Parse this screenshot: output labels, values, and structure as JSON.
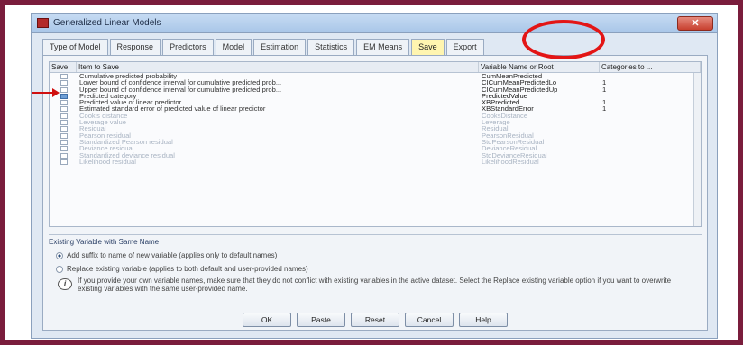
{
  "dialog": {
    "title": "Generalized Linear Models",
    "close_label": "✕"
  },
  "tabs": [
    {
      "label": "Type of Model",
      "active": false
    },
    {
      "label": "Response",
      "active": false
    },
    {
      "label": "Predictors",
      "active": false
    },
    {
      "label": "Model",
      "active": false
    },
    {
      "label": "Estimation",
      "active": false
    },
    {
      "label": "Statistics",
      "active": false
    },
    {
      "label": "EM Means",
      "active": false
    },
    {
      "label": "Save",
      "active": true
    },
    {
      "label": "Export",
      "active": false
    }
  ],
  "table": {
    "headers": {
      "save": "Save",
      "item": "Item to Save",
      "var": "Variable Name or Root",
      "cat": "Categories to ..."
    },
    "rows": [
      {
        "item": "Cumulative predicted probability",
        "var": "CumMeanPredicted",
        "cat": "",
        "checked": false,
        "enabled": true
      },
      {
        "item": "Lower bound of confidence interval for cumulative predicted prob...",
        "var": "CICumMeanPredictedLo",
        "cat": "1",
        "checked": false,
        "enabled": true
      },
      {
        "item": "Upper bound of confidence interval for cumulative predicted prob...",
        "var": "CICumMeanPredictedUp",
        "cat": "1",
        "checked": false,
        "enabled": true
      },
      {
        "item": "Predicted category",
        "var": "PredictedValue",
        "cat": "",
        "checked": true,
        "enabled": true
      },
      {
        "item": "Predicted value of linear predictor",
        "var": "XBPredicted",
        "cat": "1",
        "checked": false,
        "enabled": true
      },
      {
        "item": "Estimated standard error of predicted value of linear predictor",
        "var": "XBStandardError",
        "cat": "1",
        "checked": false,
        "enabled": true
      },
      {
        "item": "Cook's distance",
        "var": "CooksDistance",
        "cat": "",
        "checked": false,
        "enabled": false
      },
      {
        "item": "Leverage value",
        "var": "Leverage",
        "cat": "",
        "checked": false,
        "enabled": false
      },
      {
        "item": "Residual",
        "var": "Residual",
        "cat": "",
        "checked": false,
        "enabled": false
      },
      {
        "item": "Pearson residual",
        "var": "PearsonResidual",
        "cat": "",
        "checked": false,
        "enabled": false
      },
      {
        "item": "Standardized Pearson residual",
        "var": "StdPearsonResidual",
        "cat": "",
        "checked": false,
        "enabled": false
      },
      {
        "item": "Deviance residual",
        "var": "DevianceResidual",
        "cat": "",
        "checked": false,
        "enabled": false
      },
      {
        "item": "Standardized deviance residual",
        "var": "StdDevianceResidual",
        "cat": "",
        "checked": false,
        "enabled": false
      },
      {
        "item": "Likelihood residual",
        "var": "LikelihoodResidual",
        "cat": "",
        "checked": false,
        "enabled": false
      }
    ]
  },
  "existing": {
    "title": "Existing Variable with Same Name",
    "option1": "Add suffix to name of new variable (applies only to default names)",
    "option2": "Replace existing variable (applies to both default and user-provided names)",
    "info": "If you provide your own variable names, make sure that they do not conflict with existing variables in the active dataset. Select the Replace existing variable option if you want to overwrite existing variables with the same user-provided name."
  },
  "buttons": {
    "ok": "OK",
    "paste": "Paste",
    "reset": "Reset",
    "cancel": "Cancel",
    "help": "Help"
  }
}
